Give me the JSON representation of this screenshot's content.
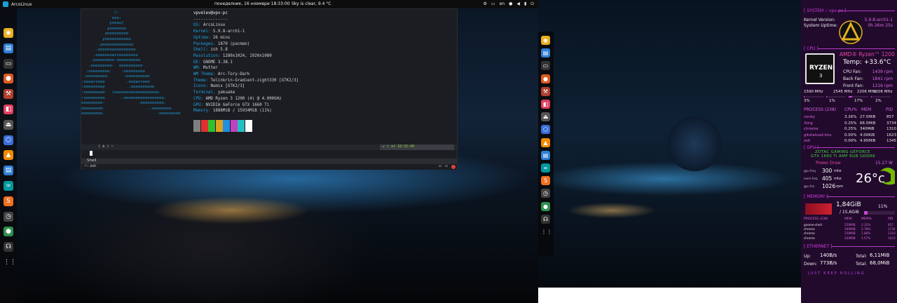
{
  "topbar": {
    "app": "ArcoLinux",
    "clock": "понеделник, 16 ноември 18:33:00",
    "weather": "Sky is clear, 9.4 °C",
    "lang": "en"
  },
  "neofetch": {
    "art": "              /-\n             ooo:\n            yoooo/\n           yooooooo\n          yooooooooo\n         yooooooooooo\n       .yooooooooooooo\n      .oooooooooooooooo\n     .oooooooarcoooooooo\n    .ooooooooo-oooooooooo\n   .ooooooooo-  oooooooooo\n  :ooooooooo.    :ooooooooo\n :ooooooooo.      :oooooooooo\n:oooarcooo         .oooarcooo\n:ooooooooy          .oooooooooo\n:ooooooooo   /ooooooooooooooooooo\n:ooooooooo      .-ooooooooooooooooo.\nooooooooo-              -oooooooooo.\nooooooooo-                  .-oooooooo.\nooooooooo.                      -ooooooooo",
    "user": "vpvelev@vpv-pc",
    "sep": "--------------",
    "rows": [
      {
        "k": "OS: ",
        "v": "ArcoLinux"
      },
      {
        "k": "Kernel: ",
        "v": "5.9.8-arch1-1"
      },
      {
        "k": "Uptime: ",
        "v": "26 mins"
      },
      {
        "k": "Packages: ",
        "v": "1870 (pacman)"
      },
      {
        "k": "Shell: ",
        "v": "zsh 5.8"
      },
      {
        "k": "Resolution: ",
        "v": "1280x1024, 1920x1080"
      },
      {
        "k": "DE: ",
        "v": "GNOME 3.38.1"
      },
      {
        "k": "WM: ",
        "v": "Mutter"
      },
      {
        "k": "WM Theme: ",
        "v": "Arc-Tory-Dark"
      },
      {
        "k": "Theme: ",
        "v": "Telinkrin-Gradient-zight330 [GTK2/3]"
      },
      {
        "k": "Icons: ",
        "v": "Numix [GTK2/3]"
      },
      {
        "k": "Terminal: ",
        "v": "yakuake"
      },
      {
        "k": "CPU: ",
        "v": "AMD Ryzen 3 1200 (4) @ 4.000GHz"
      },
      {
        "k": "GPU: ",
        "v": "NVIDIA GeForce GTX 1660 Ti"
      },
      {
        "k": "Memory: ",
        "v": "1888MiB / 15934MiB (11%)"
      }
    ],
    "colors": [
      "#7f7f7f",
      "#e03030",
      "#30c030",
      "#e0a020",
      "#2090e0",
      "#c040c0",
      "#20c0c0",
      "#ffffff"
    ]
  },
  "terminal": {
    "prompt_left": "( ᕕ )  ~",
    "prompt_right": "✔  ( at 18:32:40",
    "tab": "Shell",
    "shell_line": "~: zsh"
  },
  "dock_left": [
    {
      "n": "chrome-icon",
      "c": "#e8b020",
      "g": "◉"
    },
    {
      "n": "document-icon",
      "c": "#2f7fd8",
      "g": "▤"
    },
    {
      "n": "terminal-icon",
      "c": "#333",
      "g": "▭"
    },
    {
      "n": "firefox-icon",
      "c": "#e05a20",
      "g": "●"
    },
    {
      "n": "hammer-icon",
      "c": "#b04030",
      "g": "⚒"
    },
    {
      "n": "toggle-icon",
      "c": "#e04060",
      "g": "◧"
    },
    {
      "n": "eject-icon",
      "c": "#555",
      "g": "⏏"
    },
    {
      "n": "cube-icon",
      "c": "#3a6fd8",
      "g": "⬡"
    },
    {
      "n": "vlc-icon",
      "c": "#f08a00",
      "g": "▲"
    },
    {
      "n": "writer-icon",
      "c": "#2f7fd8",
      "g": "▤"
    },
    {
      "n": "arduino-icon",
      "c": "#00979d",
      "g": "∞"
    },
    {
      "n": "sublime-icon",
      "c": "#f07020",
      "g": "S"
    },
    {
      "n": "clock-icon",
      "c": "#444",
      "g": "◷"
    },
    {
      "n": "globe-icon",
      "c": "#2f8f4f",
      "g": "●"
    },
    {
      "n": "teamspeak-icon",
      "c": "#333",
      "g": "☊"
    },
    {
      "n": "apps-grid-icon",
      "c": "transparent",
      "g": "⋮⋮"
    }
  ],
  "conky": {
    "system_header": "[ SYSTEM :: vpv-pc ]",
    "kernel_label": "Kernel Version:",
    "kernel_value": "5.9.8-arch1-1",
    "uptime_label": "System Uptime:",
    "uptime_value": "0h 26m 25s",
    "cpu_header": "[ CPU ]",
    "cpu_name": "AMD® Ryzen™ 1200",
    "cpu_temp": "Temp: +33.6°C",
    "cpu_fan": "CPU Fan:",
    "cpu_fan_v": "1439 rpm",
    "back_fan": "Back Fan:",
    "back_fan_v": "1841 rpm",
    "front_fan": "Front Fan:",
    "front_fan_v": "1216 rpm",
    "freqs": [
      "1590 MHz",
      "2545 MHz",
      "2206 MHz",
      "2206 MHz"
    ],
    "loads": [
      "3%",
      "1%",
      "17%",
      "2%"
    ],
    "proc_head": [
      "PROCESS (238)",
      "CPU%",
      "MEM",
      "PID"
    ],
    "procs": [
      [
        "conky",
        "3.26%",
        "27.5MiB",
        "857"
      ],
      [
        "Xorg",
        "0.25%",
        "66.5MiB",
        "3734"
      ],
      [
        "chrome",
        "0.25%",
        "340MiB",
        "1310"
      ],
      [
        "gitstatusd-linu",
        "0.00%",
        "4.00KiB",
        "1623"
      ],
      [
        "zsh",
        "0.00%",
        "4.95MiB",
        "1345"
      ]
    ],
    "gpu_header": "[ GPU ]",
    "gpu_name1": "ZOTAC GAMING GEFORCE",
    "gpu_name2": "GTX 1660 Ti AMP 6GB GDDR6",
    "power_label": "Power Draw",
    "power_value": "15.27 W",
    "gpu_freq_l": "gpu freq",
    "gpu_freq": "300",
    "gpu_freq_u": "mhz",
    "mem_freq_l": "mem freq",
    "mem_freq": "405",
    "mem_freq_u": "mhz",
    "gpu_fan_l": "gpu fan",
    "gpu_fan": "1026",
    "gpu_fan_u": "rpm",
    "gpu_temp": "26°c",
    "mem_header": "[ MEMORY ]",
    "mem_used": "1,84GiB",
    "mem_total": "/ 15,6GiB",
    "mem_pct": "11%",
    "mem_frac": 0.11,
    "mproc_head": [
      "PROCESS (238)",
      "MEM",
      "MEM%",
      "PID"
    ],
    "mprocs": [
      [
        "gnome-shell",
        "259MiB",
        "2.31%",
        "857"
      ],
      [
        "chrome",
        "340MiB",
        "2.78%",
        "3734"
      ],
      [
        "chrome",
        "258MiB",
        "1.88%",
        "1310"
      ],
      [
        "chrome",
        "244MiB",
        "1.57%",
        "1623"
      ]
    ],
    "eth_header": "[ ETHERNET ]",
    "up_l": "Up:",
    "up_v": "140B/s",
    "total_l1": "Total:",
    "total_v1": "6,11MiB",
    "down_l": "Down:",
    "down_v": "773B/s",
    "total_l2": "Total:",
    "total_v2": "68,0MiB",
    "footer": "JUST KEEP ROLLING"
  }
}
